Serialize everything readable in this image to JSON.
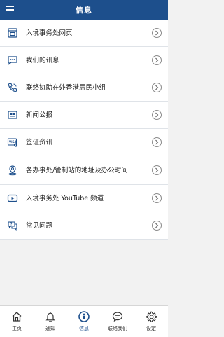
{
  "header": {
    "title": "信息"
  },
  "colors": {
    "primary": "#1d4f8c",
    "background": "#f2f2f2"
  },
  "menu": [
    {
      "label": "入境事务处网页",
      "icon": "webpage-icon"
    },
    {
      "label": "我们的讯息",
      "icon": "message-icon"
    },
    {
      "label": "联络协助在外香港居民小组",
      "icon": "phone-icon"
    },
    {
      "label": "新闻公报",
      "icon": "news-icon"
    },
    {
      "label": "签证资讯",
      "icon": "visa-icon"
    },
    {
      "label": "各办事处/管制站的地址及办公时间",
      "icon": "location-icon"
    },
    {
      "label": "入境事务处 YouTube 频道",
      "icon": "youtube-icon"
    },
    {
      "label": "常见问题",
      "icon": "faq-icon"
    }
  ],
  "tabs": [
    {
      "label": "主页",
      "icon": "home-icon"
    },
    {
      "label": "通知",
      "icon": "bell-icon"
    },
    {
      "label": "信息",
      "icon": "info-icon",
      "active": true
    },
    {
      "label": "联络我们",
      "icon": "contact-icon"
    },
    {
      "label": "设定",
      "icon": "settings-icon"
    }
  ]
}
